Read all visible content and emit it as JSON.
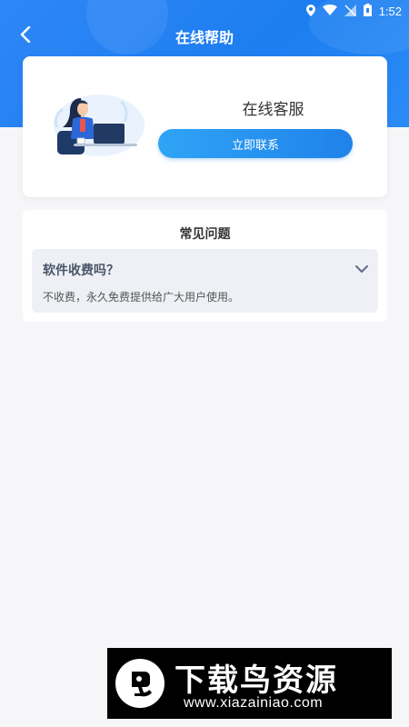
{
  "status_bar": {
    "time": "1:52"
  },
  "header": {
    "title": "在线帮助"
  },
  "service": {
    "title": "在线客服",
    "button_label": "立即联系"
  },
  "faq": {
    "title": "常见问题",
    "items": [
      {
        "question": "软件收费吗？",
        "answer": "不收费，永久免费提供给广大用户使用。"
      }
    ]
  },
  "watermark": {
    "title": "下载鸟资源",
    "url": "www.xiazainiao.com"
  },
  "colors": {
    "primary": "#1f82ea",
    "header": "#2f86f6",
    "background": "#f6f6f9"
  }
}
